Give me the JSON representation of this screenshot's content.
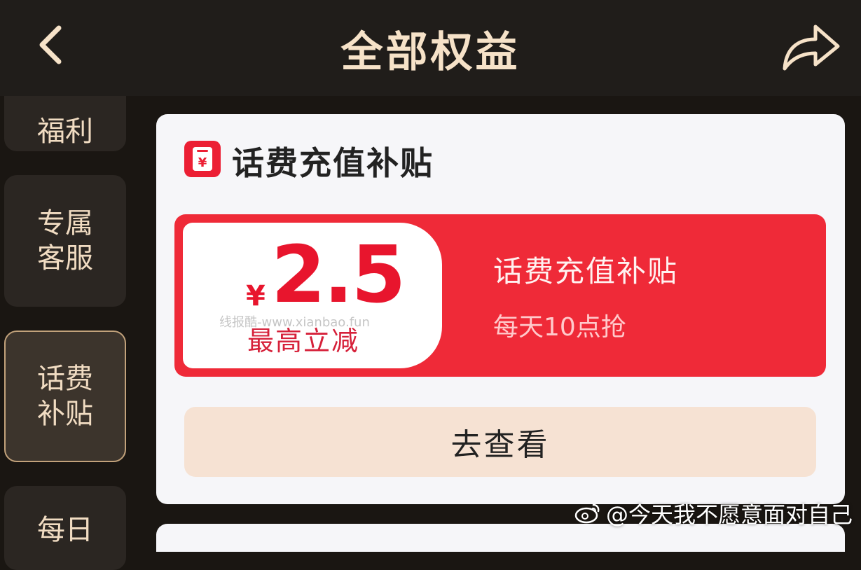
{
  "header": {
    "title": "全部权益",
    "back_icon": "chevron-left-icon",
    "share_icon": "share-arrow-icon"
  },
  "sidebar": {
    "items": [
      {
        "label": "福利"
      },
      {
        "label": "专属客服"
      },
      {
        "label": "话费补贴",
        "active": true
      },
      {
        "label": "每日"
      }
    ]
  },
  "card": {
    "title": "话费充值补贴",
    "icon": "yuan-wallet-icon",
    "coupon": {
      "currency": "¥",
      "amount": "2.5",
      "subtitle": "最高立减",
      "name": "话费充值补贴",
      "time_note": "每天10点抢",
      "watermark": "线报酷-www.xianbao.fun"
    },
    "action_label": "去查看"
  },
  "colors": {
    "accent_red": "#ef2a38",
    "header_text": "#f6e2c8",
    "button_bg": "#f6e2d3"
  },
  "footer_watermark": "@今天我不愿意面对自己"
}
